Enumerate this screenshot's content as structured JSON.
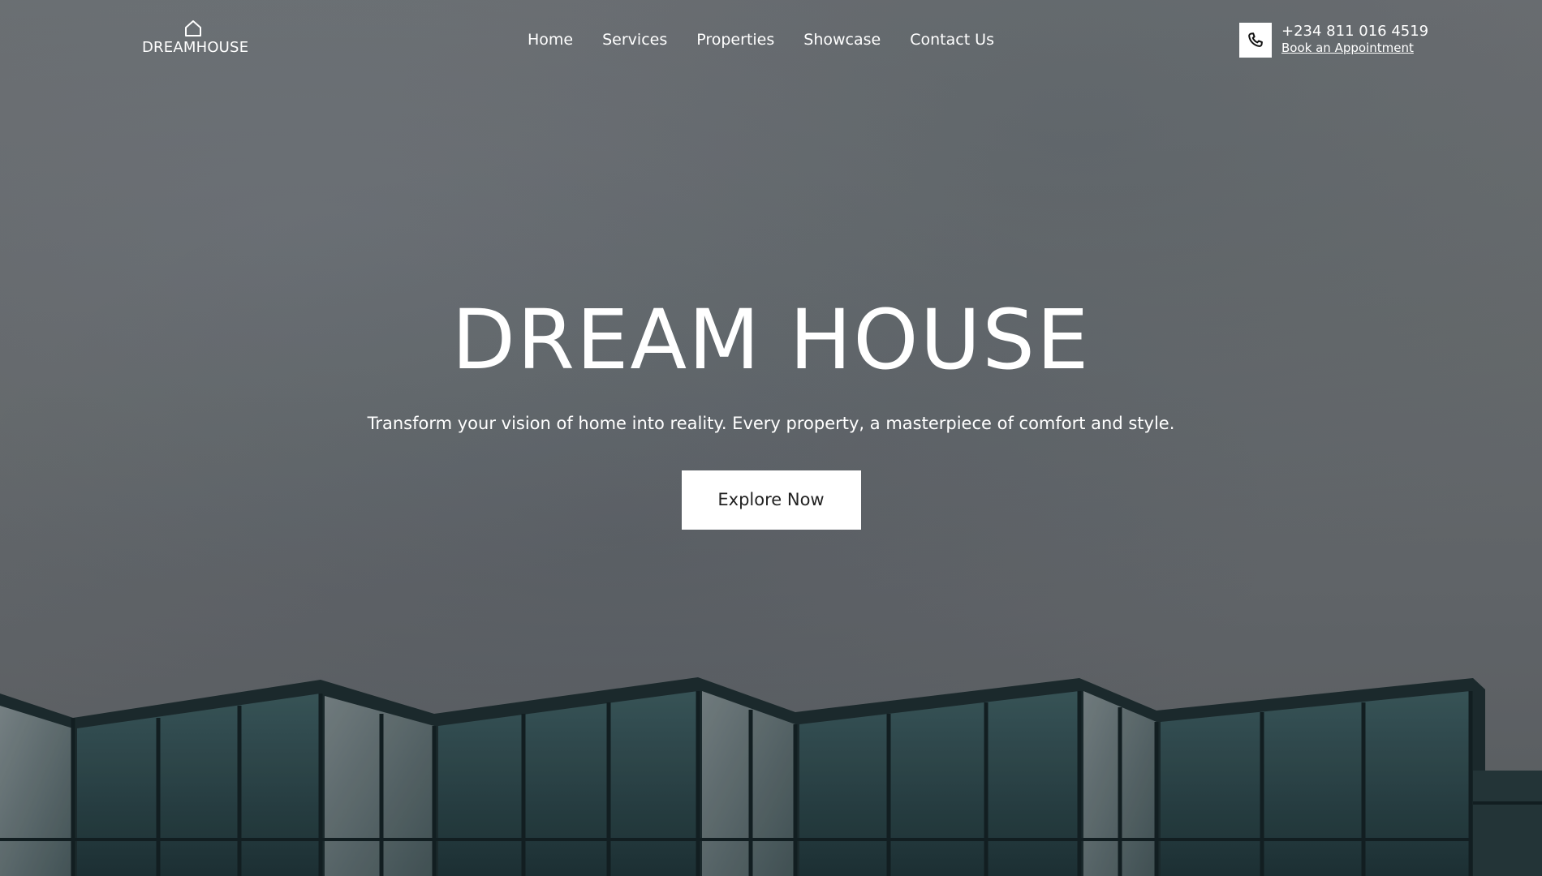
{
  "header": {
    "logo_text": "DREAMHOUSE",
    "logo_icon": "house-icon",
    "nav": [
      "Home",
      "Services",
      "Properties",
      "Showcase",
      "Contact Us"
    ],
    "phone_icon": "phone-icon",
    "phone_number": "+234 811 016 4519",
    "appointment_link": "Book an Appointment"
  },
  "hero": {
    "title": "DREAM HOUSE",
    "subtitle": "Transform your vision of home into reality. Every property, a masterpiece of comfort and style.",
    "cta_label": "Explore Now"
  },
  "colors": {
    "overlay": "#6d7174",
    "text": "#ffffff",
    "button_bg": "#ffffff",
    "button_text": "#222222",
    "glass": "#2f4a4f"
  }
}
